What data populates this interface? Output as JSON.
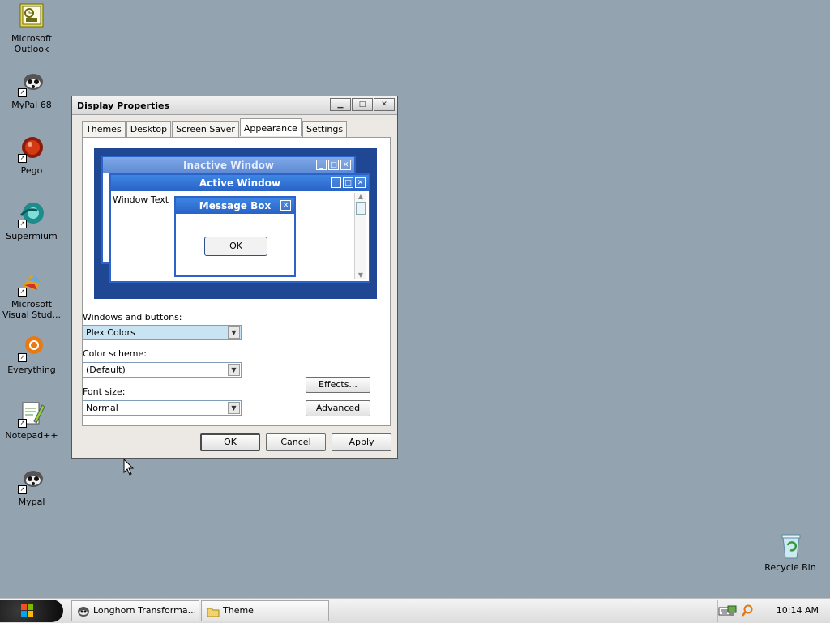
{
  "desktop": {
    "icons": [
      {
        "label": "Microsoft\nOutlook",
        "name": "outlook-icon"
      },
      {
        "label": "MyPal 68",
        "name": "mypal68-icon"
      },
      {
        "label": "Pego",
        "name": "pego-icon"
      },
      {
        "label": "Supermium",
        "name": "supermium-icon"
      },
      {
        "label": "Microsoft Visual Stud...",
        "name": "visual-studio-icon"
      },
      {
        "label": "Everything",
        "name": "everything-icon"
      },
      {
        "label": "Notepad++",
        "name": "notepadpp-icon"
      },
      {
        "label": "Mypal",
        "name": "mypal-icon"
      },
      {
        "label": "Recycle Bin",
        "name": "recycle-bin-icon"
      }
    ]
  },
  "dialog": {
    "title": "Display Properties",
    "tabs": [
      "Themes",
      "Desktop",
      "Screen Saver",
      "Appearance",
      "Settings"
    ],
    "active_tab": "Appearance",
    "preview": {
      "inactive_title": "Inactive Window",
      "active_title": "Active Window",
      "window_text": "Window Text",
      "message_box_title": "Message Box",
      "message_ok": "OK"
    },
    "windows_buttons_label": "Windows and buttons:",
    "windows_buttons_value": "Plex Colors",
    "color_scheme_label": "Color scheme:",
    "color_scheme_value": "(Default)",
    "font_size_label": "Font size:",
    "font_size_value": "Normal",
    "effects_label": "Effects...",
    "advanced_label": "Advanced",
    "ok_label": "OK",
    "cancel_label": "Cancel",
    "apply_label": "Apply"
  },
  "taskbar": {
    "buttons": [
      "Longhorn Transforma...",
      "Theme"
    ],
    "clock": "10:14 AM"
  },
  "colors": {
    "desktop": "#94a3b0",
    "preview_background": "#1f4793",
    "title_active": "#2a62c6"
  }
}
